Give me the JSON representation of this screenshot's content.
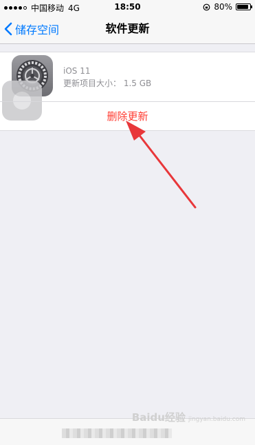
{
  "status_bar": {
    "carrier": "中国移动",
    "network": "4G",
    "time": "18:50",
    "battery": "80%"
  },
  "nav": {
    "back_label": "储存空间",
    "title": "软件更新"
  },
  "update": {
    "name": "iOS 11",
    "size_text": "更新项目大小： 1.5 GB",
    "delete_label": "删除更新"
  },
  "colors": {
    "accent": "#007aff",
    "destructive": "#ff3b30",
    "annotation_arrow": "#e8373a",
    "background": "#efeff4"
  },
  "watermark": {
    "text": "Baidu经验",
    "sub": "jingyan.baidu.com"
  }
}
